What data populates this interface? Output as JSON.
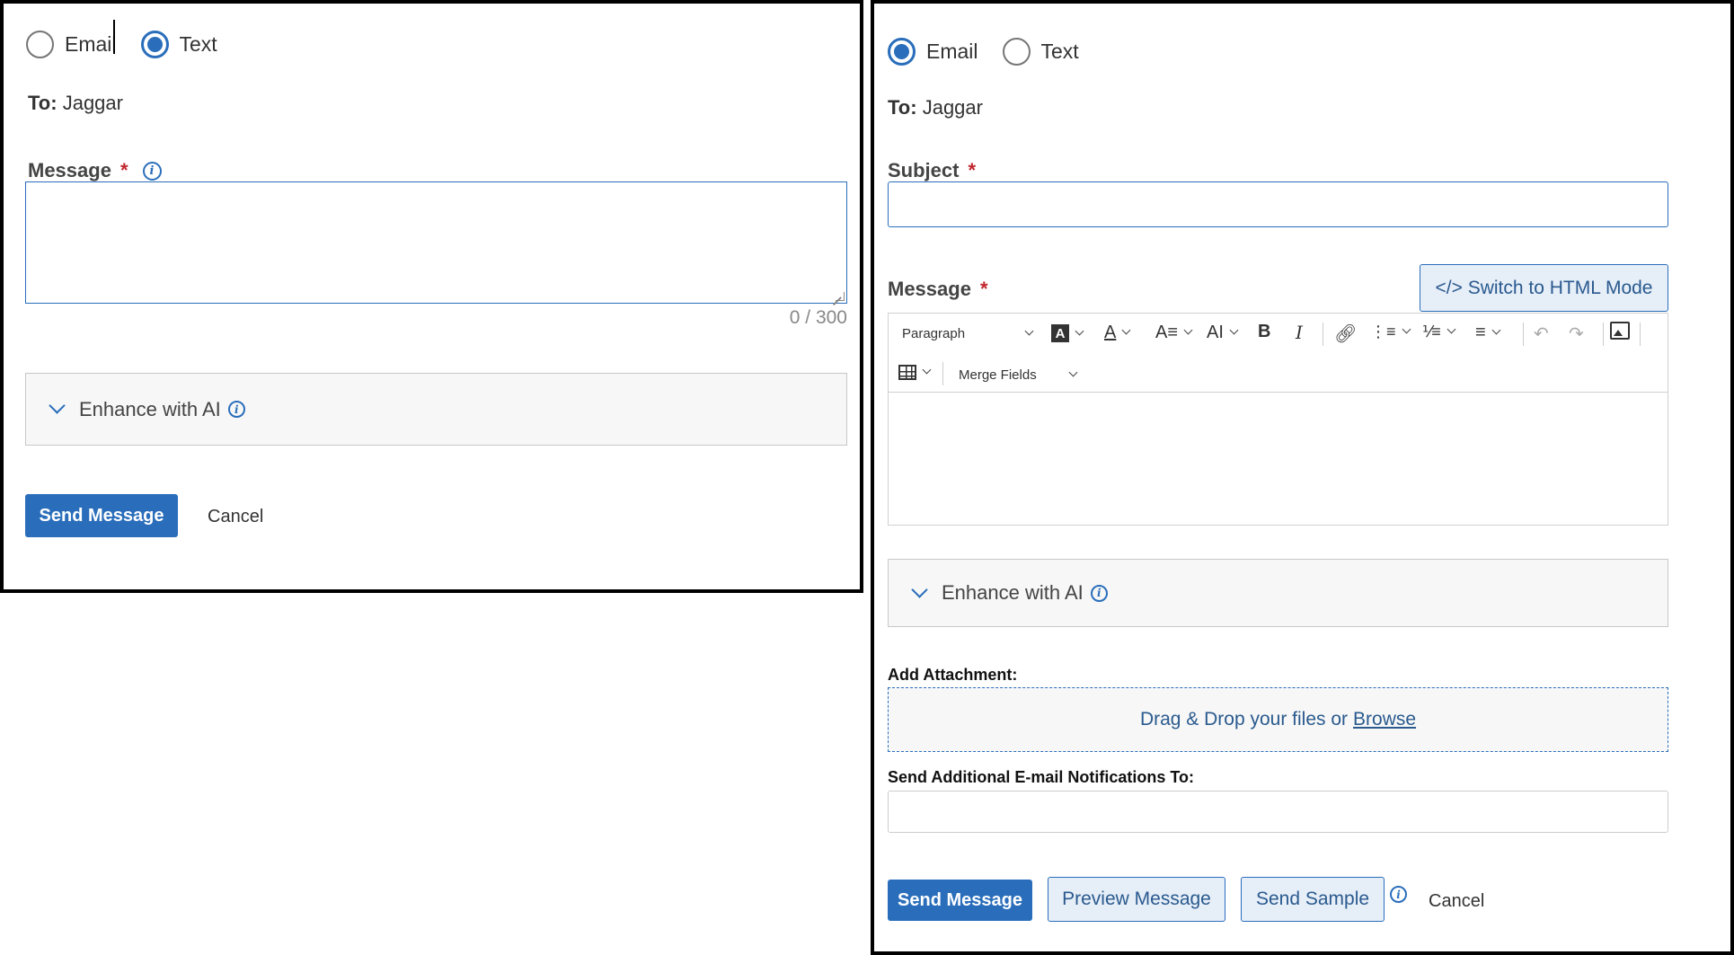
{
  "text_panel": {
    "radio_email": "Email",
    "radio_text": "Text",
    "selected": "Text",
    "to_label": "To:",
    "to_value": "Jaggar",
    "message_label": "Message",
    "required_mark": "*",
    "message_value": "",
    "counter": "0 / 300",
    "enhance_label": "Enhance with AI",
    "send_label": "Send Message",
    "cancel_label": "Cancel"
  },
  "email_panel": {
    "radio_email": "Email",
    "radio_text": "Text",
    "selected": "Email",
    "to_label": "To:",
    "to_value": "Jaggar",
    "subject_label": "Subject",
    "required_mark": "*",
    "subject_value": "",
    "message_label": "Message",
    "switch_html_label": "</> Switch to HTML Mode",
    "toolbar": {
      "paragraph_label": "Paragraph",
      "merge_fields_label": "Merge Fields",
      "bold_glyph": "B",
      "italic_glyph": "I"
    },
    "enhance_label": "Enhance with AI",
    "attachment_label": "Add Attachment:",
    "dropzone_text": "Drag & Drop your files or",
    "browse_label": "Browse",
    "notifications_label": "Send Additional E-mail Notifications To:",
    "notifications_value": "",
    "send_label": "Send Message",
    "preview_label": "Preview Message",
    "sample_label": "Send Sample",
    "cancel_label": "Cancel"
  },
  "colors": {
    "accent": "#2a6ebb",
    "required": "#c0262d",
    "enhance_bg": "#f7f7f7"
  }
}
